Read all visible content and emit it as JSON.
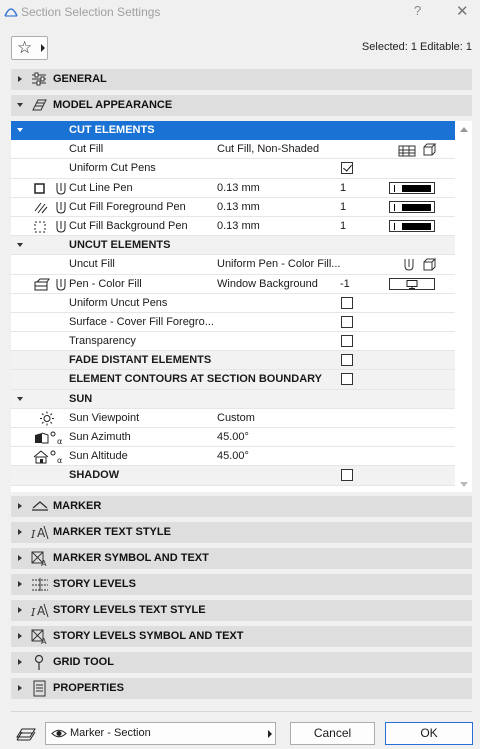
{
  "window": {
    "title": "Section Selection Settings",
    "help": "?",
    "close": "✕"
  },
  "toolbar": {
    "selected_info": "Selected: 1 Editable: 1"
  },
  "sections_top": [
    {
      "label": "GENERAL",
      "expanded": false
    },
    {
      "label": "MODEL APPEARANCE",
      "expanded": true
    }
  ],
  "panel": {
    "rows": [
      {
        "kind": "group",
        "label": "CUT ELEMENTS",
        "highlighted": true
      },
      {
        "kind": "prop",
        "name": "Cut Fill",
        "value": "Cut Fill, Non-Shaded",
        "right_icon": "fill-pattern-icon"
      },
      {
        "kind": "prop",
        "name": "Uniform Cut Pens",
        "checkbox": true,
        "checked": true
      },
      {
        "kind": "prop",
        "name": "Cut Line Pen",
        "value": "0.13 mm",
        "num": "1",
        "pen_sample": true,
        "left_icon": "cut-line-pen-icon"
      },
      {
        "kind": "prop",
        "name": "Cut Fill Foreground Pen",
        "value": "0.13 mm",
        "num": "1",
        "pen_sample": true,
        "left_icon": "fill-foreground-pen-icon"
      },
      {
        "kind": "prop",
        "name": "Cut Fill Background Pen",
        "value": "0.13 mm",
        "num": "1",
        "pen_sample": true,
        "left_icon": "fill-background-pen-icon"
      },
      {
        "kind": "group",
        "label": "UNCUT ELEMENTS"
      },
      {
        "kind": "prop",
        "name": "Uncut Fill",
        "value": "Uniform Pen - Color Fill...",
        "right_icon": "pen-fill-icon"
      },
      {
        "kind": "prop",
        "name": "Pen - Color Fill",
        "value": "Window Background",
        "num": "-1",
        "monitor": true,
        "left_icon": "color-fill-pen-icon"
      },
      {
        "kind": "prop",
        "name": "Uniform Uncut Pens",
        "checkbox": true,
        "checked": false
      },
      {
        "kind": "prop",
        "name": "Surface - Cover Fill Foregro...",
        "checkbox": true,
        "checked": false
      },
      {
        "kind": "prop",
        "name": "Transparency",
        "checkbox": true,
        "checked": false
      },
      {
        "kind": "boldprop",
        "name": "FADE DISTANT ELEMENTS",
        "checkbox": true,
        "checked": false
      },
      {
        "kind": "boldprop",
        "name": "ELEMENT CONTOURS AT SECTION BOUNDARY",
        "checkbox": true,
        "checked": false
      },
      {
        "kind": "group",
        "label": "SUN"
      },
      {
        "kind": "prop",
        "name": "Sun Viewpoint",
        "value": "Custom",
        "left_icon": "sun-icon"
      },
      {
        "kind": "prop",
        "name": "Sun Azimuth",
        "value": "45.00°",
        "left_icon": "sun-azimuth-icon"
      },
      {
        "kind": "prop",
        "name": "Sun Altitude",
        "value": "45.00°",
        "left_icon": "sun-altitude-icon"
      },
      {
        "kind": "boldprop",
        "name": "SHADOW",
        "checkbox": true,
        "checked": false
      }
    ]
  },
  "sections_bottom": [
    {
      "label": "MARKER",
      "icon": "marker-icon"
    },
    {
      "label": "MARKER TEXT STYLE",
      "icon": "text-style-icon"
    },
    {
      "label": "MARKER SYMBOL AND TEXT",
      "icon": "symbol-text-icon"
    },
    {
      "label": "STORY LEVELS",
      "icon": "story-levels-icon"
    },
    {
      "label": "STORY LEVELS TEXT STYLE",
      "icon": "text-style-icon"
    },
    {
      "label": "STORY LEVELS SYMBOL AND TEXT",
      "icon": "symbol-text-icon"
    },
    {
      "label": "GRID TOOL",
      "icon": "grid-tool-icon"
    },
    {
      "label": "PROPERTIES",
      "icon": "properties-icon"
    }
  ],
  "footer": {
    "marker_select": "Marker - Section",
    "cancel": "Cancel",
    "ok": "OK"
  },
  "colors": {
    "highlight": "#1a73d4",
    "section_bg": "#dedede",
    "window_bg": "#f0f0f0"
  }
}
